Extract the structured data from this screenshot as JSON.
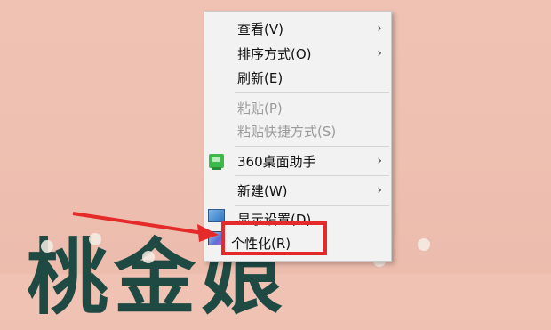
{
  "wallpaper": {
    "text": "桃金娘"
  },
  "menu": {
    "items": [
      {
        "label": "查看(V)",
        "has_submenu": true,
        "disabled": false
      },
      {
        "label": "排序方式(O)",
        "has_submenu": true,
        "disabled": false
      },
      {
        "label": "刷新(E)",
        "has_submenu": false,
        "disabled": false
      },
      {
        "label": "粘贴(P)",
        "has_submenu": false,
        "disabled": true
      },
      {
        "label": "粘贴快捷方式(S)",
        "has_submenu": false,
        "disabled": true
      },
      {
        "label": "360桌面助手",
        "has_submenu": true,
        "disabled": false,
        "icon": "360-desktop-helper-icon"
      },
      {
        "label": "新建(W)",
        "has_submenu": true,
        "disabled": false
      },
      {
        "label": "显示设置(D)",
        "has_submenu": false,
        "disabled": false,
        "icon": "display-settings-icon"
      },
      {
        "label": "个性化(R)",
        "has_submenu": false,
        "disabled": false,
        "icon": "personalize-icon"
      }
    ],
    "submenu_arrow": "›"
  },
  "colors": {
    "highlight": "#e52a2a",
    "menu_bg": "#f2f2f2",
    "wallpaper": "#eec0b1"
  }
}
